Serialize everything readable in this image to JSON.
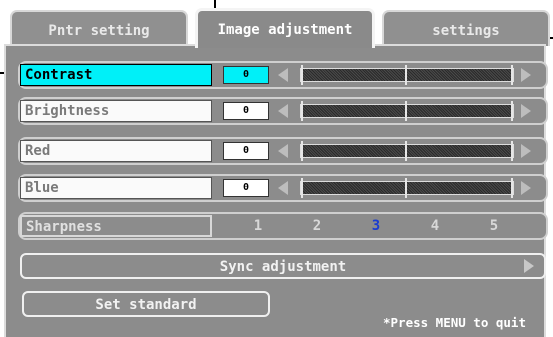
{
  "tabs": [
    {
      "label": "Pntr setting",
      "active": false
    },
    {
      "label": "Image adjustment",
      "active": true
    },
    {
      "label": "settings",
      "active": false
    }
  ],
  "rows": [
    {
      "label": "Contrast",
      "value": "0",
      "level": 0,
      "active": true
    },
    {
      "label": "Brightness",
      "value": "0",
      "level": 0,
      "active": false
    },
    {
      "label": "Red",
      "value": "0",
      "level": 0,
      "active": false
    },
    {
      "label": "Blue",
      "value": "0",
      "level": 0,
      "active": false
    }
  ],
  "sharpness": {
    "label": "Sharpness",
    "options": [
      "1",
      "2",
      "3",
      "4",
      "5"
    ],
    "selected": "3"
  },
  "buttons": {
    "sync": "Sync adjustment",
    "set_standard": "Set standard"
  },
  "hint": "*Press MENU to quit",
  "colors": {
    "panel_bg": "#8c8c8c",
    "highlight": "#00f0f8",
    "selected_option": "#1a3cd0"
  },
  "icons": {
    "slider_left": "triangle-left-icon",
    "slider_right": "triangle-right-icon",
    "sync_arrow": "triangle-right-icon"
  }
}
